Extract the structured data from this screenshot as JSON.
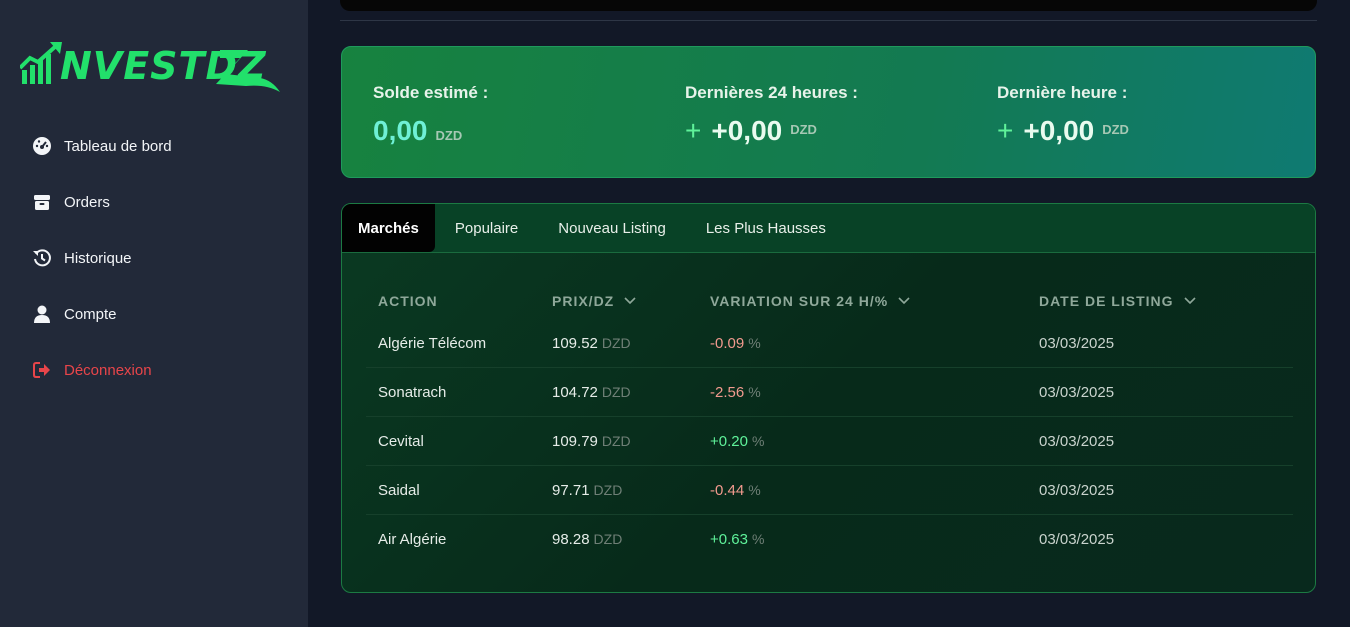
{
  "brand": {
    "name": "NVESTDZ",
    "accent": "#22e06b"
  },
  "sidebar": {
    "items": [
      {
        "label": "Tableau de bord",
        "icon": "gauge-icon"
      },
      {
        "label": "Orders",
        "icon": "box-icon"
      },
      {
        "label": "Historique",
        "icon": "history-icon"
      },
      {
        "label": "Compte",
        "icon": "user-icon"
      },
      {
        "label": "Déconnexion",
        "icon": "logout-icon",
        "color": "#e8454a"
      }
    ]
  },
  "balance": {
    "estimated": {
      "label": "Solde estimé :",
      "value": "0,00",
      "unit": "DZD"
    },
    "last24h": {
      "label": "Dernières 24 heures :",
      "value": "+0,00",
      "unit": "DZD"
    },
    "lastHour": {
      "label": "Dernière heure :",
      "value": "+0,00",
      "unit": "DZD"
    }
  },
  "market": {
    "tabs": [
      "Marchés",
      "Populaire",
      "Nouveau Listing",
      "Les Plus Hausses"
    ],
    "active_tab": "Marchés",
    "columns": [
      "ACTION",
      "PRIX/DZ",
      "VARIATION SUR 24 H/%",
      "DATE DE LISTING"
    ],
    "rows": [
      {
        "name": "Algérie Télécom",
        "price": "109.52",
        "currency": "DZD",
        "change": "-0.09",
        "pct": "%",
        "date": "03/03/2025",
        "trend": "down"
      },
      {
        "name": "Sonatrach",
        "price": "104.72",
        "currency": "DZD",
        "change": "-2.56",
        "pct": "%",
        "date": "03/03/2025",
        "trend": "down"
      },
      {
        "name": "Cevital",
        "price": "109.79",
        "currency": "DZD",
        "change": "+0.20",
        "pct": "%",
        "date": "03/03/2025",
        "trend": "up"
      },
      {
        "name": "Saidal",
        "price": "97.71",
        "currency": "DZD",
        "change": "-0.44",
        "pct": "%",
        "date": "03/03/2025",
        "trend": "down"
      },
      {
        "name": "Air Algérie",
        "price": "98.28",
        "currency": "DZD",
        "change": "+0.63",
        "pct": "%",
        "date": "03/03/2025",
        "trend": "up"
      }
    ]
  }
}
